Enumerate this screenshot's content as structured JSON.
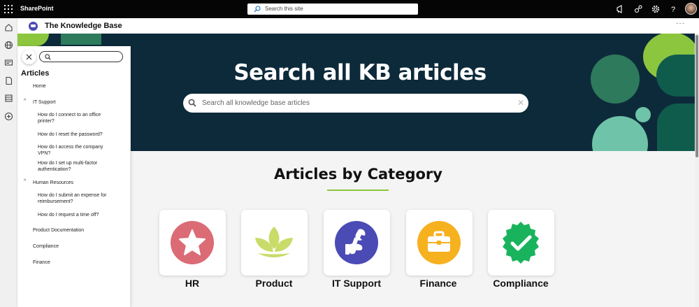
{
  "suite": {
    "brand": "SharePoint",
    "search_placeholder": "Search this site"
  },
  "site": {
    "title": "The Knowledge Base",
    "more_label": "···"
  },
  "hero": {
    "heading": "Search all KB articles",
    "search_placeholder": "Search all knowledge base articles",
    "clear_label": "✕"
  },
  "nav": {
    "heading": "Articles",
    "search_value": "",
    "items": [
      {
        "label": "Home",
        "level": 0
      },
      {
        "label": "IT Support",
        "level": 0,
        "expanded": true
      },
      {
        "label": "How do I connect to an office printer?",
        "level": 1
      },
      {
        "label": "How do I reset the password?",
        "level": 1
      },
      {
        "label": "How do I access the company VPN?",
        "level": 1
      },
      {
        "label": "How do I set up multi-factor authentication?",
        "level": 1
      },
      {
        "label": "Human Resources",
        "level": 0,
        "expanded": true
      },
      {
        "label": "How do I submit an expense for reimbursement?",
        "level": 1
      },
      {
        "label": "How do I request a time off?",
        "level": 1
      },
      {
        "label": "Product Documentation",
        "level": 0
      },
      {
        "label": "Compliance",
        "level": 0
      },
      {
        "label": "Finance",
        "level": 0
      }
    ]
  },
  "categories": {
    "heading": "Articles by Category",
    "items": [
      {
        "label": "HR",
        "icon": "star-icon",
        "color": "#db6b75"
      },
      {
        "label": "Product",
        "icon": "leaves-icon",
        "color": "#c9dc6a"
      },
      {
        "label": "IT Support",
        "icon": "wrench-hand-icon",
        "color": "#4b4bb5"
      },
      {
        "label": "Finance",
        "icon": "briefcase-icon",
        "color": "#f6b11f"
      },
      {
        "label": "Compliance",
        "icon": "check-badge-icon",
        "color": "#1ab35d"
      }
    ]
  },
  "colors": {
    "hero_bg": "#0d2a3a",
    "accent_green": "#8cc63f",
    "suite_bar": "#050505"
  }
}
